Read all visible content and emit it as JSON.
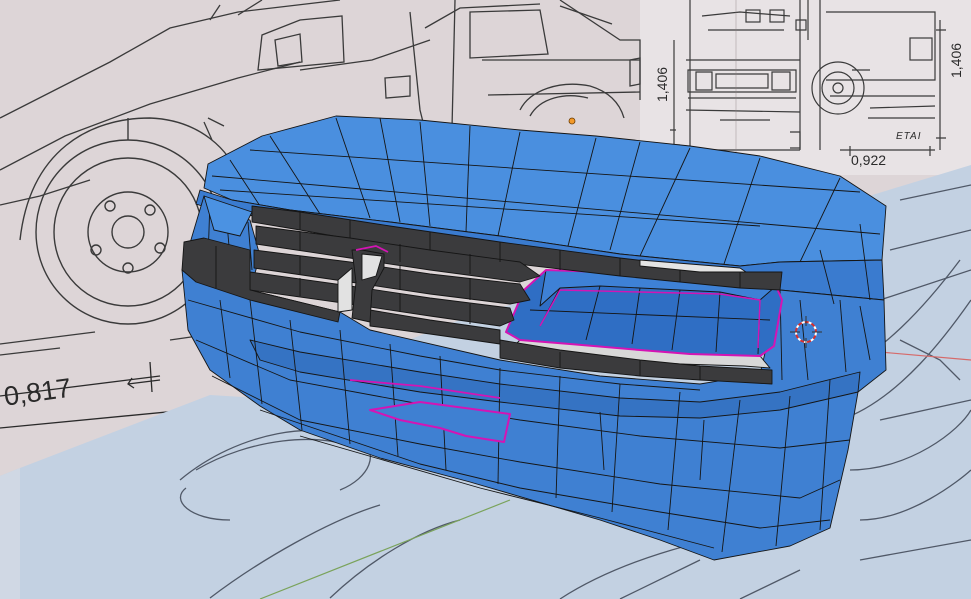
{
  "blueprint": {
    "side_width_dimension": "0,817",
    "front_width_dimension": "0,922",
    "front_height_dimension": "1,406",
    "rear_height_dimension": "1,406",
    "rear_label": "ETAI"
  },
  "viewport": {
    "mode": "edit-mode",
    "cursor_icon": "3d-cursor-icon"
  },
  "colors": {
    "mesh_face": "#3d7fd0",
    "mesh_face_light": "#4a90e0",
    "mesh_face_dark": "#2f69b4",
    "grille_bar": "#3b3b3d",
    "selection_edge": "#d414b4",
    "wire": "#111111",
    "background_ref": "#ded6d8",
    "ground_plane": "#c2d0e1",
    "axis_x": "#d66a6a",
    "axis_y": "#7aa35b"
  }
}
